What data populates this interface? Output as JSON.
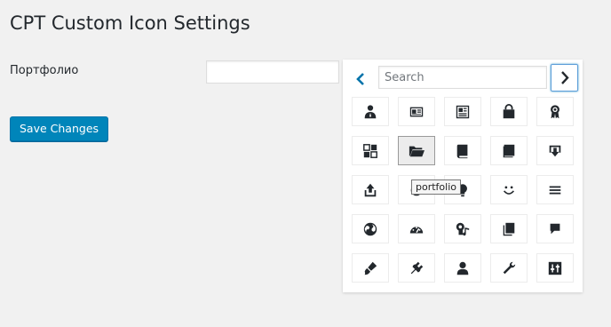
{
  "page": {
    "title": "CPT Custom Icon Settings"
  },
  "settings": {
    "field_label": "Портфолио",
    "field_value": "",
    "save_label": "Save Changes"
  },
  "picker": {
    "search_placeholder": "Search",
    "search_value": "",
    "prev_icon": "chevron-left-icon",
    "next_icon": "chevron-right-icon",
    "selected": "portfolio",
    "tooltip": "portfolio",
    "icons": [
      "businessman-icon",
      "id-icon",
      "id-alt-icon",
      "products-icon",
      "awards-icon",
      "forms-icon",
      "portfolio-icon",
      "book-icon",
      "book-alt-icon",
      "download-icon",
      "upload-icon",
      "backup-icon",
      "lightbulb-icon",
      "smiley-icon",
      "menu-icon",
      "translation-icon",
      "performance-icon",
      "media-interactive-icon",
      "admin-page-icon",
      "admin-comments-icon",
      "admin-appearance-icon",
      "admin-plugins-icon",
      "admin-users-icon",
      "admin-tools-icon",
      "admin-settings-icon"
    ]
  },
  "colors": {
    "accent": "#0085ba",
    "link": "#0073aa",
    "icon": "#23282d"
  }
}
